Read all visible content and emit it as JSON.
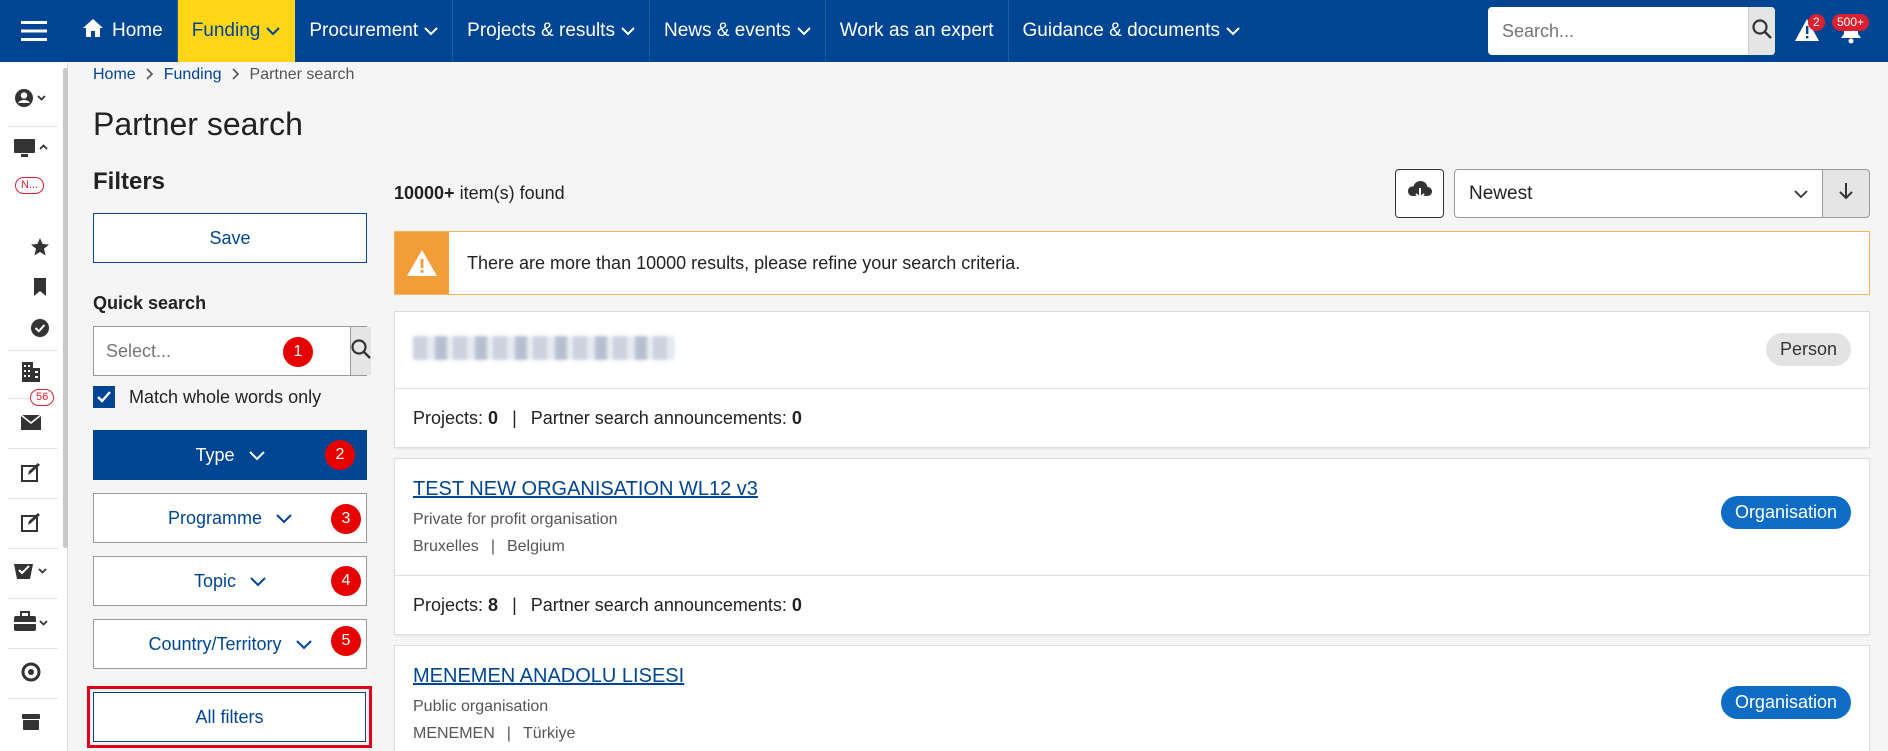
{
  "nav": {
    "home": "Home",
    "items": [
      {
        "label": "Funding"
      },
      {
        "label": "Procurement"
      },
      {
        "label": "Projects & results"
      },
      {
        "label": "News & events"
      },
      {
        "label": "Work as an expert"
      },
      {
        "label": "Guidance & documents"
      }
    ],
    "search_placeholder": "Search...",
    "alerts_count": "2",
    "notifications_count": "500+"
  },
  "rail": {
    "badge_new": "N...",
    "badge_messages": "56"
  },
  "breadcrumb": {
    "home": "Home",
    "funding": "Funding",
    "current": "Partner search"
  },
  "page_title": "Partner search",
  "filters": {
    "title": "Filters",
    "save": "Save",
    "quick_search_label": "Quick search",
    "quick_search_placeholder": "Select...",
    "match_whole_words": "Match whole words only",
    "type": "Type",
    "programme": "Programme",
    "topic": "Topic",
    "country": "Country/Territory",
    "all_filters": "All filters",
    "badges": [
      "1",
      "2",
      "3",
      "4",
      "5"
    ]
  },
  "results": {
    "count": "10000+",
    "count_suffix": " item(s) found",
    "sort": "Newest",
    "warning": "There are more than 10000 results, please refine your search criteria.",
    "projects_label": "Projects:",
    "announcements_label": "Partner search announcements:",
    "cards": [
      {
        "name": "",
        "tag": "Person",
        "projects": "0",
        "announcements": "0"
      },
      {
        "name": "TEST NEW ORGANISATION WL12 v3",
        "type": "Private for profit organisation",
        "city": "Bruxelles",
        "country": "Belgium",
        "tag": "Organisation",
        "projects": "8",
        "announcements": "0"
      },
      {
        "name": "MENEMEN ANADOLU LISESI",
        "type": "Public organisation",
        "city": "MENEMEN",
        "country": "Türkiye",
        "tag": "Organisation"
      }
    ]
  },
  "colors": {
    "primary": "#004494",
    "accent": "#ffd617",
    "warning": "#f29d38",
    "badge": "#e60000",
    "org_tag": "#0e6cc4"
  }
}
